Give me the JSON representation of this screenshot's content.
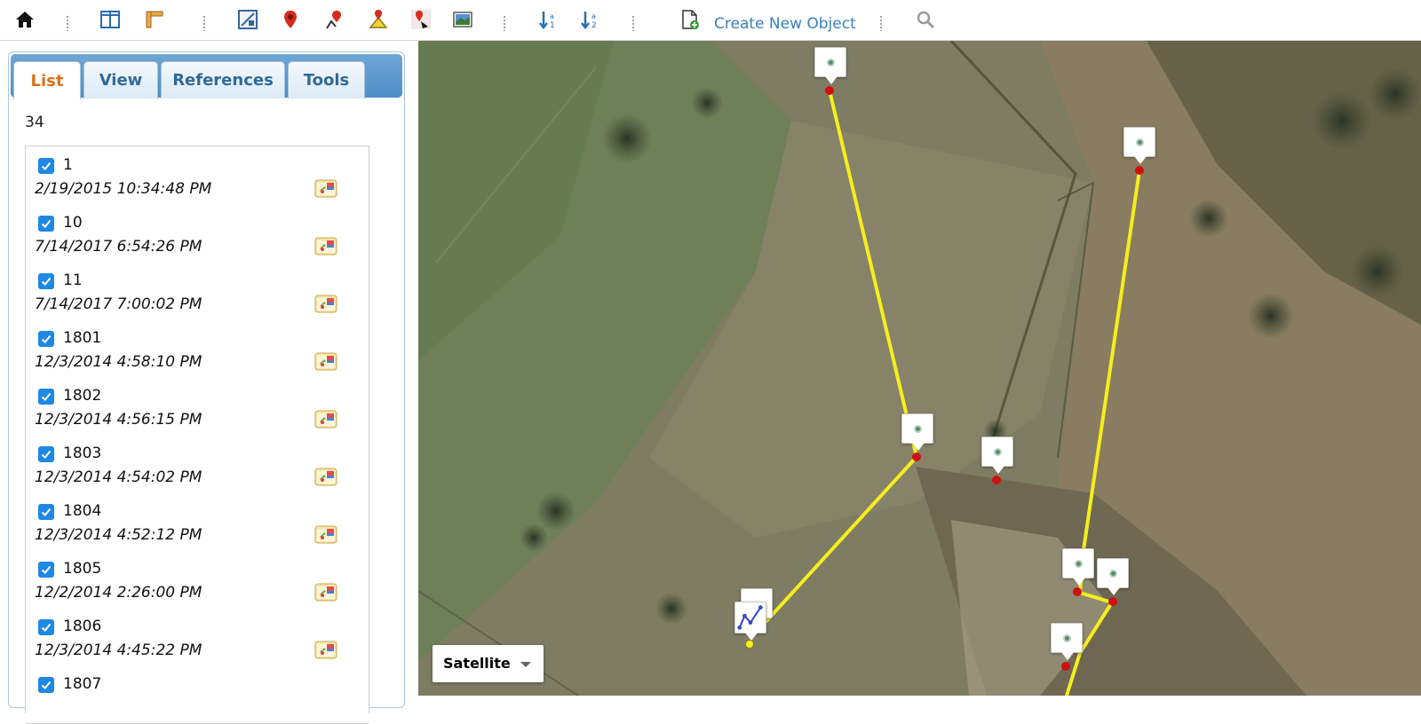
{
  "toolbar": {
    "create_label": "Create New Object",
    "icons": [
      "home-icon",
      "panel-icon",
      "ruler-icon",
      "image-edit-icon",
      "placemark-icon",
      "polyline-icon",
      "polygon-icon",
      "path-icon",
      "picture-icon",
      "sort-asc-icon",
      "sort-desc-icon",
      "new-object-icon",
      "search-icon"
    ]
  },
  "tabs": [
    {
      "label": "List",
      "active": true
    },
    {
      "label": "View",
      "active": false
    },
    {
      "label": "References",
      "active": false
    },
    {
      "label": "Tools",
      "active": false
    }
  ],
  "list": {
    "count": "34",
    "items": [
      {
        "name": "1",
        "date": "2/19/2015 10:34:48 PM",
        "checked": true
      },
      {
        "name": "10",
        "date": "7/14/2017 6:54:26 PM",
        "checked": true
      },
      {
        "name": "11",
        "date": "7/14/2017 7:00:02 PM",
        "checked": true
      },
      {
        "name": "1801",
        "date": "12/3/2014 4:58:10 PM",
        "checked": true
      },
      {
        "name": "1802",
        "date": "12/3/2014 4:56:15 PM",
        "checked": true
      },
      {
        "name": "1803",
        "date": "12/3/2014 4:54:02 PM",
        "checked": true
      },
      {
        "name": "1804",
        "date": "12/3/2014 4:52:12 PM",
        "checked": true
      },
      {
        "name": "1805",
        "date": "12/2/2014 2:26:00 PM",
        "checked": true
      },
      {
        "name": "1806",
        "date": "12/3/2014 4:45:22 PM",
        "checked": true
      },
      {
        "name": "1807",
        "date": "",
        "checked": true
      }
    ]
  },
  "map": {
    "map_type": "Satellite",
    "track_color": "#f5ee1e",
    "marker_color": "#d01010"
  }
}
